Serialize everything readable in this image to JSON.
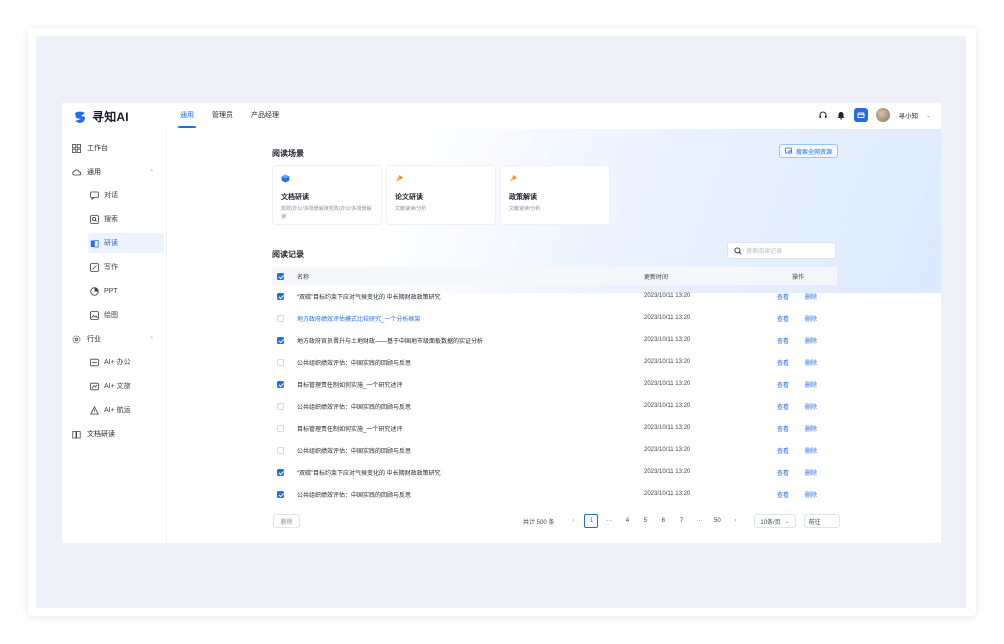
{
  "app": {
    "logo_text": "寻知AI"
  },
  "nav": {
    "items": [
      "通用",
      "管理员",
      "产品经理"
    ],
    "active_index": 0
  },
  "user": {
    "name": "寻小知"
  },
  "sidebar": {
    "items": [
      {
        "label": "工作台",
        "icon": "grid-icon"
      },
      {
        "label": "通用",
        "icon": "cloud-icon",
        "expanded": true
      },
      {
        "label": "对话",
        "icon": "chat-icon"
      },
      {
        "label": "搜索",
        "icon": "search-icon"
      },
      {
        "label": "研读",
        "icon": "book-icon",
        "active": true
      },
      {
        "label": "写作",
        "icon": "pen-icon"
      },
      {
        "label": "PPT",
        "icon": "ppt-icon"
      },
      {
        "label": "绘图",
        "icon": "image-icon"
      },
      {
        "label": "行业",
        "icon": "gear-icon",
        "expanded": true
      },
      {
        "label": "AI+ 办公",
        "icon": "office-icon"
      },
      {
        "label": "AI+ 文旅",
        "icon": "travel-icon"
      },
      {
        "label": "AI+ 航运",
        "icon": "ship-icon"
      },
      {
        "label": "文档研读",
        "icon": "document-icon"
      }
    ]
  },
  "reading_scene": {
    "title": "阅读场景",
    "search_web_label": "搜索全网资源",
    "cards": [
      {
        "title": "文档研读",
        "desc": "党政/办公/多场景解读党政/办公/多场景解读",
        "icon_color": "#1f6fe8"
      },
      {
        "title": "论文研读",
        "desc": "文献速读/分析",
        "icon_color": "#f08a24"
      },
      {
        "title": "政策解读",
        "desc": "文献速读/分析",
        "icon_color": "#f08a24"
      }
    ]
  },
  "records": {
    "title": "阅读记录",
    "search_placeholder": "搜索阅读记录",
    "columns": {
      "name": "名称",
      "time": "更新时间",
      "ops": "操作"
    },
    "view_label": "查看",
    "delete_label": "删除",
    "rows": [
      {
        "name": "“双碳”目标约束下应对气候变化的 中长期财政政策研究",
        "time": "2023/10/11 13:20",
        "checked": true
      },
      {
        "name": "地方政府绩效评估模式比较研究_一个分析框架",
        "time": "2023/10/11 13:20",
        "checked": false,
        "hover": true
      },
      {
        "name": "地方政府官员晋升与土地财政——基于中国地市级面板数据的实证分析",
        "time": "2023/10/11 13:20",
        "checked": true
      },
      {
        "name": "公共组织绩效评估：中国实践的回顾与反思",
        "time": "2023/10/11 13:20",
        "checked": false
      },
      {
        "name": "目标管理责任制如何实施_一个研究述评",
        "time": "2023/10/11 13:20",
        "checked": true
      },
      {
        "name": "公共组织绩效评估：中国实践的回顾与反思",
        "time": "2023/10/11 13:20",
        "checked": false
      },
      {
        "name": "目标管理责任制如何实施_一个研究述评",
        "time": "2023/10/11 13:20",
        "checked": false
      },
      {
        "name": "公共组织绩效评估：中国实践的回顾与反思",
        "time": "2023/10/11 13:20",
        "checked": false
      },
      {
        "name": "“双碳”目标约束下应对气候变化的 中长期财政政策研究",
        "time": "2023/10/11 13:20",
        "checked": true
      },
      {
        "name": "公共组织绩效评估：中国实践的回顾与反思",
        "time": "2023/10/11 13:20",
        "checked": true
      }
    ]
  },
  "footer": {
    "delete_button": "删除",
    "total": "共计 500 条",
    "pages": [
      "1",
      "···",
      "4",
      "5",
      "6",
      "7",
      "···",
      "50"
    ],
    "current_page": "1",
    "page_size": "10条/页",
    "goto_label": "前往"
  }
}
